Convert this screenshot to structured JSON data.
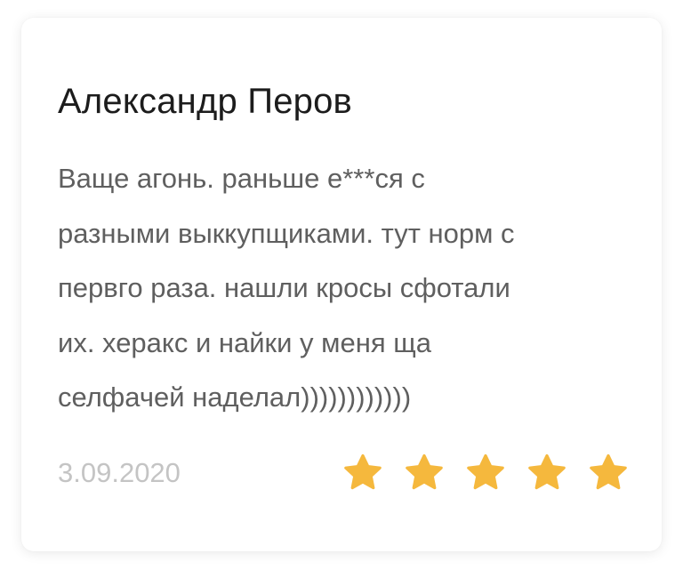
{
  "review": {
    "author": "Александр Перов",
    "text": "Ваще агонь. раньше е***ся с\nразными выккупщиками. тут норм с\nпервго раза. нашли кросы сфотали\nих. херакс и найки у меня ща\nселфачей наделал))))))))))))",
    "date": "3.09.2020",
    "rating": 5,
    "rating_max": 5
  },
  "colors": {
    "star": "#f5b83d",
    "author": "#1c1c1c",
    "text": "#5f5f5f",
    "date": "#c4c4c4"
  }
}
